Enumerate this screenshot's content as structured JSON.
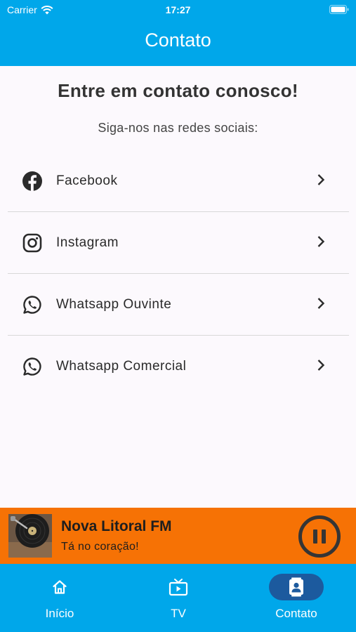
{
  "status_bar": {
    "carrier": "Carrier",
    "time": "17:27"
  },
  "app_bar": {
    "title": "Contato"
  },
  "main": {
    "heading": "Entre em contato conosco!",
    "subheading": "Siga-nos nas redes sociais:",
    "links": [
      {
        "label": "Facebook",
        "icon": "facebook-icon"
      },
      {
        "label": "Instagram",
        "icon": "instagram-icon"
      },
      {
        "label": "Whatsapp Ouvinte",
        "icon": "whatsapp-icon"
      },
      {
        "label": "Whatsapp Comercial",
        "icon": "whatsapp-icon"
      }
    ]
  },
  "player": {
    "station": "Nova Litoral FM",
    "slogan": "Tá no coração!",
    "state": "playing",
    "control_icon": "pause-icon"
  },
  "bottom_nav": {
    "items": [
      {
        "label": "Início",
        "icon": "home-icon",
        "active": false
      },
      {
        "label": "TV",
        "icon": "tv-icon",
        "active": false
      },
      {
        "label": "Contato",
        "icon": "contact-card-icon",
        "active": true
      }
    ]
  },
  "colors": {
    "primary": "#00a7ea",
    "player_bg": "#f67205",
    "nav_active_pill": "#1c5a9e",
    "page_bg": "#fcf9fd"
  }
}
